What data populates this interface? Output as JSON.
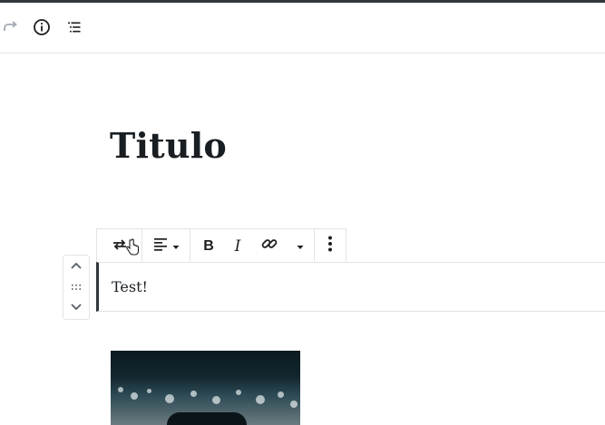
{
  "colors": {
    "accent_dark": "#32373c",
    "border": "#e2e4e7",
    "text": "#191e23",
    "icon": "#555d66",
    "disabled": "#a2aab2"
  },
  "header": {
    "redo": {
      "icon": "redo-icon",
      "disabled": true
    },
    "info": {
      "icon": "info-icon"
    },
    "outline": {
      "icon": "list-icon"
    }
  },
  "post": {
    "title": "Titulo"
  },
  "block_toolbar": {
    "transform": {
      "icon": "transform-icon"
    },
    "align": {
      "icon": "align-left-icon",
      "dropdown": "caret-down-icon"
    },
    "bold": {
      "label": "B"
    },
    "italic": {
      "label": "I"
    },
    "link": {
      "icon": "link-icon"
    },
    "more_formats": {
      "icon": "caret-down-icon"
    },
    "more_options": {
      "icon": "more-vertical-icon"
    }
  },
  "block": {
    "content": "Test!"
  },
  "mover": {
    "up": {
      "icon": "chevron-up-icon"
    },
    "drag": {
      "icon": "drag-handle-icon"
    },
    "down": {
      "icon": "chevron-down-icon"
    }
  }
}
